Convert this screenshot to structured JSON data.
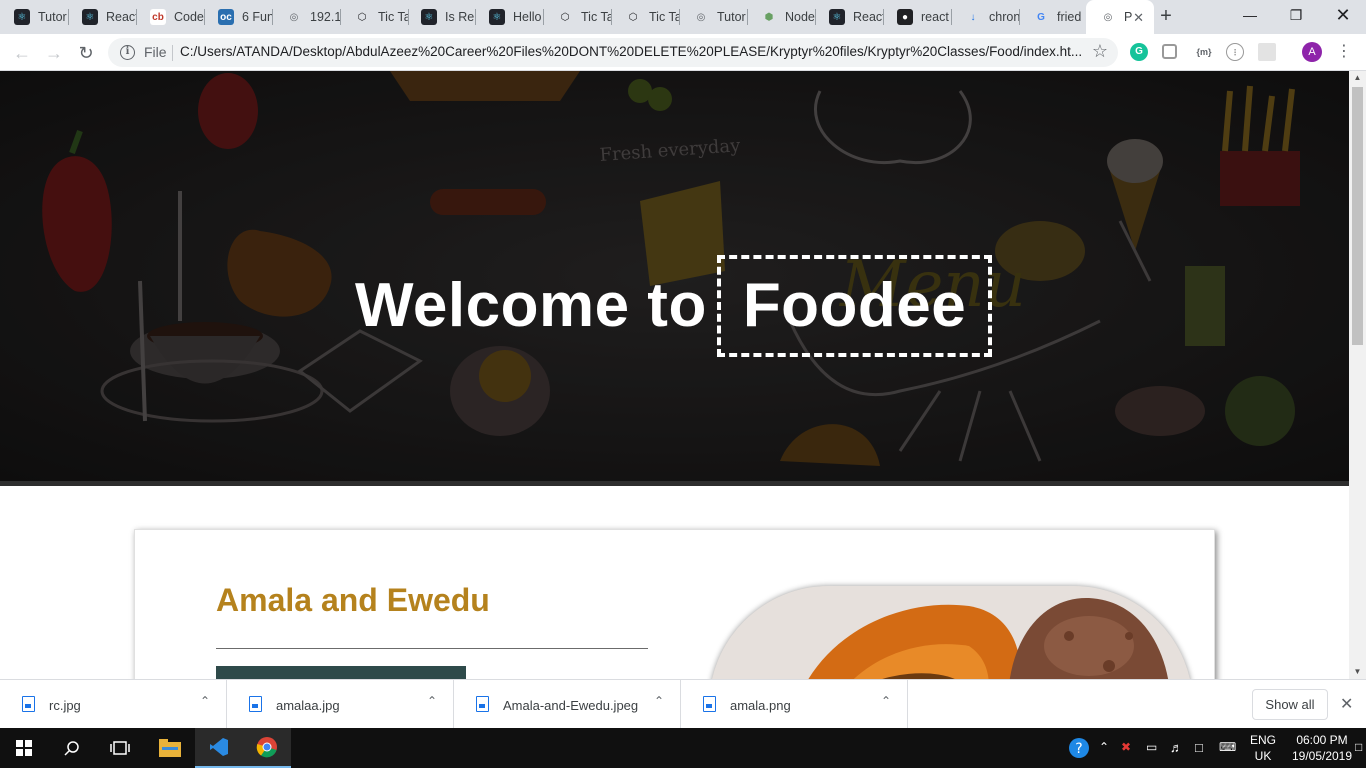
{
  "browser": {
    "tabs": [
      {
        "label": "Tutor",
        "icon": "react-icon"
      },
      {
        "label": "React",
        "icon": "react-icon"
      },
      {
        "label": "Code",
        "icon": "codeburst-icon"
      },
      {
        "label": "6 Fun",
        "icon": "dev-icon"
      },
      {
        "label": "192.1",
        "icon": "globe-icon"
      },
      {
        "label": "Tic Ta",
        "icon": "codepen-icon"
      },
      {
        "label": "Is Re",
        "icon": "react-icon"
      },
      {
        "label": "Hello",
        "icon": "react-icon"
      },
      {
        "label": "Tic Ta",
        "icon": "codepen-icon"
      },
      {
        "label": "Tic Ta",
        "icon": "codepen-icon"
      },
      {
        "label": "Tutor",
        "icon": "globe-icon"
      },
      {
        "label": "Node",
        "icon": "node-icon"
      },
      {
        "label": "React",
        "icon": "react-icon"
      },
      {
        "label": "react",
        "icon": "github-icon"
      },
      {
        "label": "chron",
        "icon": "download-icon"
      },
      {
        "label": "fried",
        "icon": "google-icon"
      },
      {
        "label": "P",
        "icon": "globe-icon",
        "active": true
      }
    ],
    "scheme_label": "File",
    "url": "C:/Users/ATANDA/Desktop/AbdulAzeez%20Career%20Files%20DONT%20DELETE%20PLEASE/Kryptyr%20files/Kryptyr%20Classes/Food/index.ht...",
    "profile_initial": "A",
    "ext_code_label": "{m}"
  },
  "page": {
    "hero": {
      "lead": "Welcome to",
      "brand": "Foodee",
      "background_words": [
        "Fresh everyday",
        "Menu"
      ]
    },
    "card": {
      "title": "Amala and Ewedu"
    }
  },
  "downloads": {
    "items": [
      "rc.jpg",
      "amalaa.jpg",
      "Amala-and-Ewedu.jpeg",
      "amala.png"
    ],
    "show_all": "Show all"
  },
  "taskbar": {
    "lang_top": "ENG",
    "lang_bottom": "UK",
    "time": "06:00 PM",
    "date": "19/05/2019"
  },
  "colors": {
    "accent_title": "#b5821d",
    "card_button": "#2e4a4a",
    "hero_bg": "#1b1a1b"
  }
}
